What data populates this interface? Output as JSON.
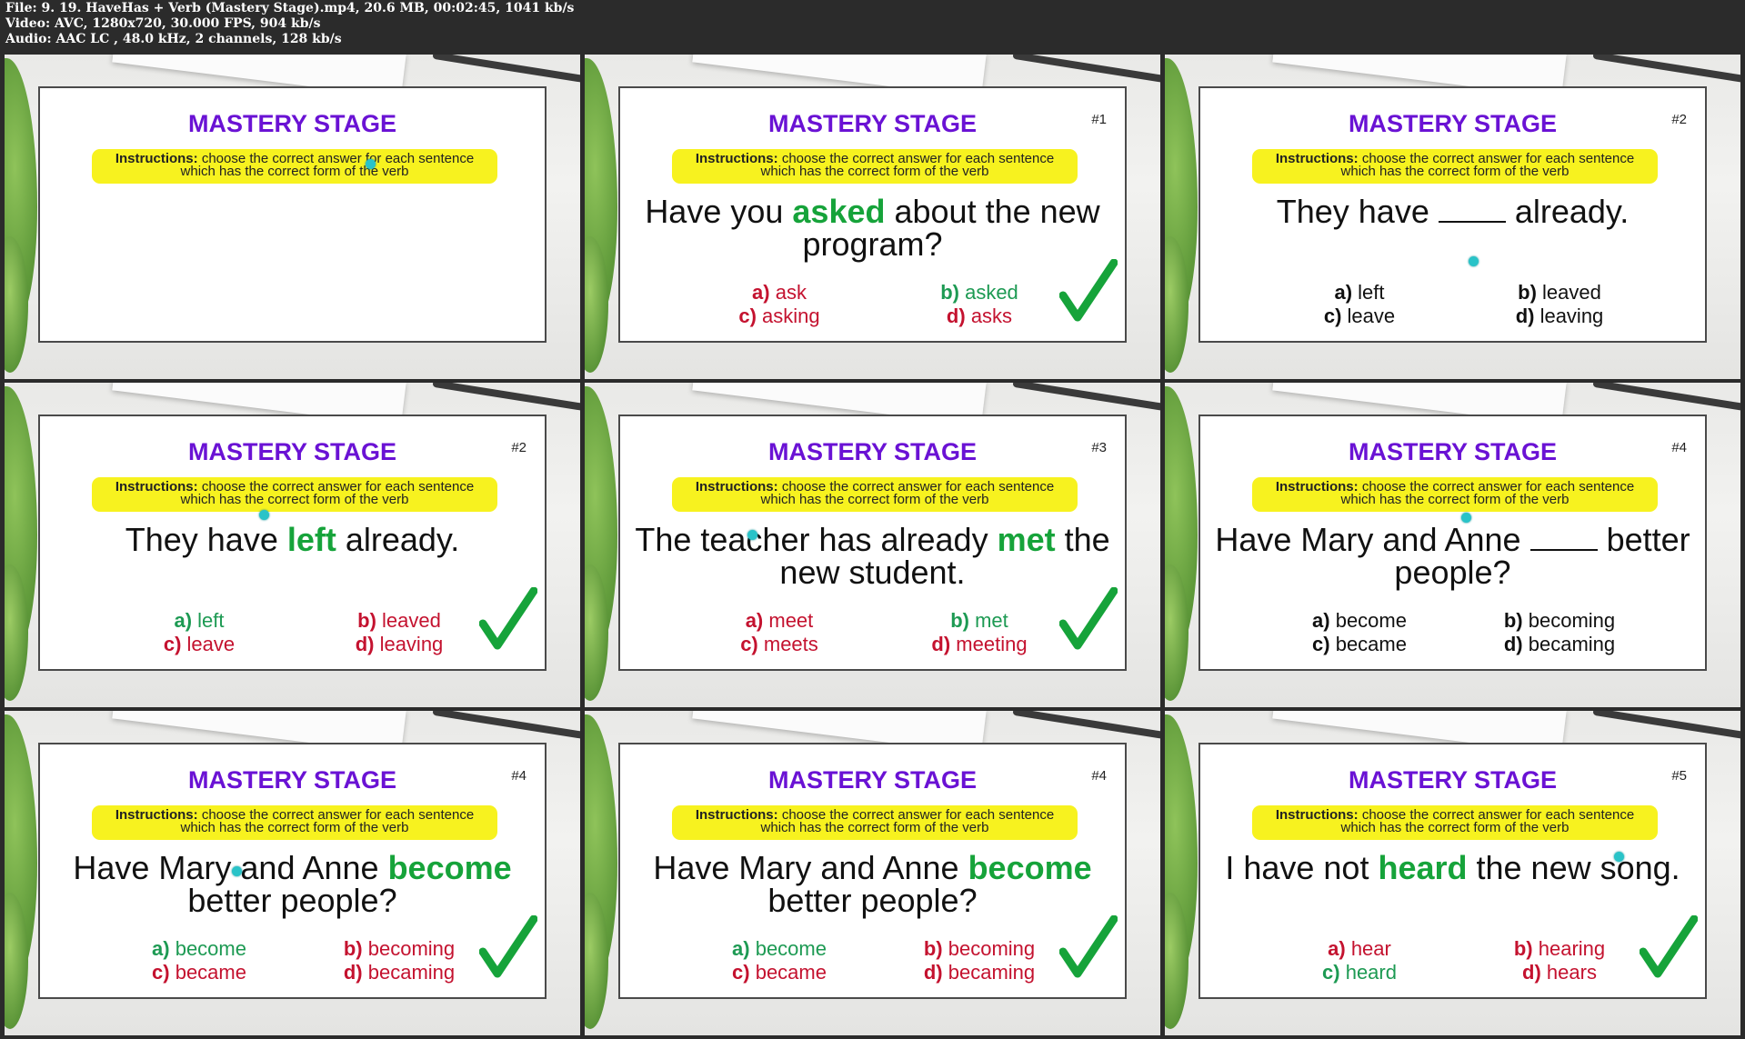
{
  "header": {
    "line1": "File: 9. 19. HaveHas + Verb (Mastery Stage).mp4, 20.6 MB, 00:02:45, 1041 kb/s",
    "line2": "Video: AVC, 1280x720, 30.000 FPS, 904 kb/s",
    "line3": "Audio: AAC LC , 48.0 kHz, 2 channels, 128 kb/s"
  },
  "slide_title": "MASTERY STAGE",
  "instructions_label": "Instructions:",
  "instructions_text_1": " choose the correct answer for each sentence",
  "instructions_text_2": "which has the correct form of the verb",
  "colors": {
    "title": "#6a12d4",
    "correct": "#16a33a",
    "wrong": "#c4122f",
    "highlight": "#f7f21f"
  },
  "thumbs": [
    {
      "num": "",
      "sent_pre": "",
      "sent_hl": "",
      "sent_post": "",
      "a": "",
      "b": "",
      "c": "",
      "d": ""
    },
    {
      "num": "#1",
      "sent_pre": "Have you ",
      "sent_hl": "asked",
      "sent_post": " about the new program?",
      "a": "ask",
      "b": "asked",
      "c": "asking",
      "d": "asks"
    },
    {
      "num": "#2",
      "sent_pre": "They have ",
      "sent_hl": "",
      "sent_post": " already.",
      "a": "left",
      "b": "leaved",
      "c": "leave",
      "d": "leaving"
    },
    {
      "num": "#2",
      "sent_pre": "They have ",
      "sent_hl": "left",
      "sent_post": " already.",
      "a": "left",
      "b": "leaved",
      "c": "leave",
      "d": "leaving"
    },
    {
      "num": "#3",
      "sent_pre": "The teacher has already ",
      "sent_hl": "met",
      "sent_post": " the new student.",
      "a": "meet",
      "b": "met",
      "c": "meets",
      "d": "meeting"
    },
    {
      "num": "#4",
      "sent_pre": "Have Mary and Anne ",
      "sent_hl": "",
      "sent_post": " better people?",
      "a": "become",
      "b": "becoming",
      "c": "became",
      "d": "becaming"
    },
    {
      "num": "#4",
      "sent_pre": "Have Mary and Anne ",
      "sent_hl": "become",
      "sent_post": " better people?",
      "a": "become",
      "b": "becoming",
      "c": "became",
      "d": "becaming"
    },
    {
      "num": "#4",
      "sent_pre": "Have Mary and Anne ",
      "sent_hl": "become",
      "sent_post": " better people?",
      "a": "become",
      "b": "becoming",
      "c": "became",
      "d": "becaming"
    },
    {
      "num": "#5",
      "sent_pre": "I have not ",
      "sent_hl": "heard",
      "sent_post": " the new song.",
      "a": "hear",
      "b": "hearing",
      "c": "heard",
      "d": "hears"
    }
  ]
}
